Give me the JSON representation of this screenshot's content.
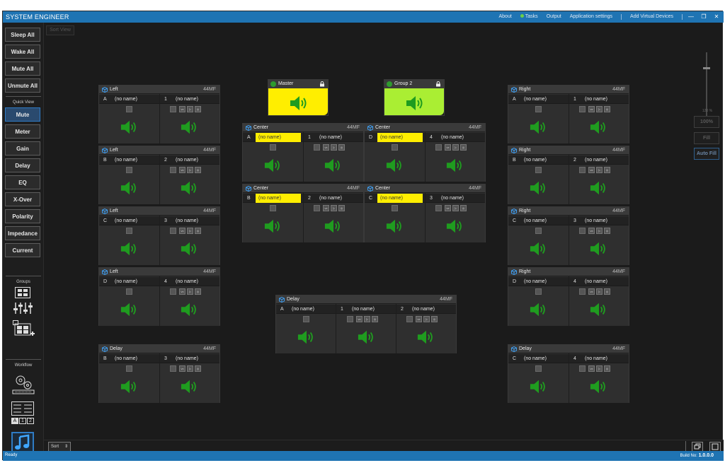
{
  "app": {
    "title": "SYSTEM ENGINEER",
    "menu": [
      "About",
      "Tasks",
      "Output",
      "Application settings",
      "Add Virtual Devices"
    ],
    "accent": "#1f74b3"
  },
  "sidebar": {
    "buttons": [
      "Sleep All",
      "Wake All",
      "Mute All",
      "Unmute All"
    ],
    "quick_view_label": "Quick View",
    "quick_view": [
      "Mute",
      "Meter",
      "Gain",
      "Delay",
      "EQ",
      "X-Over",
      "Polarity",
      "Impedance",
      "Current"
    ],
    "active_quick_view": "Mute",
    "groups_label": "Groups",
    "workflow_label": "Workflow",
    "icons": [
      "groups-grid-icon",
      "faders-icon",
      "add-group-icon",
      "settings-gears-icon",
      "list-order-icon",
      "music-note-icon"
    ],
    "order_labels": [
      "A",
      "1",
      "2"
    ]
  },
  "canvas": {
    "sort_view_label": "Sort View"
  },
  "right_rail": {
    "zoom_label": "120 %",
    "buttons": [
      "100%",
      "Fill",
      "Auto Fill"
    ]
  },
  "bottom": {
    "sort_label": "Sort"
  },
  "status": {
    "left": "Ready",
    "build_label": "Build No:",
    "build_value": "1.0.0.0"
  },
  "colors": {
    "speaker": "#1f9c1f",
    "highlight_name": "#ffee00",
    "master_group": "#ffee00",
    "group2": "#aaee33"
  },
  "groups": [
    {
      "name": "Master",
      "color": "#ffee00"
    },
    {
      "name": "Group 2",
      "color": "#aaee33"
    }
  ],
  "panels": [
    {
      "name": "Left",
      "model": "44MF",
      "channels": [
        {
          "label": "A",
          "name": "(no name)"
        },
        {
          "label": "1",
          "name": "(no name)"
        }
      ]
    },
    {
      "name": "Left",
      "model": "44MF",
      "channels": [
        {
          "label": "B",
          "name": "(no name)"
        },
        {
          "label": "2",
          "name": "(no name)"
        }
      ]
    },
    {
      "name": "Left",
      "model": "44MF",
      "channels": [
        {
          "label": "C",
          "name": "(no name)"
        },
        {
          "label": "3",
          "name": "(no name)"
        }
      ]
    },
    {
      "name": "Left",
      "model": "44MF",
      "channels": [
        {
          "label": "D",
          "name": "(no name)"
        },
        {
          "label": "4",
          "name": "(no name)"
        }
      ]
    },
    {
      "name": "Delay",
      "model": "44MF",
      "channels": [
        {
          "label": "B",
          "name": "(no name)"
        },
        {
          "label": "3",
          "name": "(no name)"
        }
      ]
    },
    {
      "name": "Center",
      "model": "44MF",
      "channels": [
        {
          "label": "A",
          "name": "(no name)",
          "hl": true
        },
        {
          "label": "1",
          "name": "(no name)"
        }
      ]
    },
    {
      "name": "Center",
      "model": "44MF",
      "channels": [
        {
          "label": "D",
          "name": "(no name)",
          "hl": true
        },
        {
          "label": "4",
          "name": "(no name)"
        }
      ]
    },
    {
      "name": "Center",
      "model": "44MF",
      "channels": [
        {
          "label": "B",
          "name": "(no name)",
          "hl": true
        },
        {
          "label": "2",
          "name": "(no name)"
        }
      ]
    },
    {
      "name": "Center",
      "model": "44MF",
      "channels": [
        {
          "label": "C",
          "name": "(no name)",
          "hl": true
        },
        {
          "label": "3",
          "name": "(no name)"
        }
      ]
    },
    {
      "name": "Delay",
      "model": "44MF",
      "channels": [
        {
          "label": "A",
          "name": "(no name)"
        },
        {
          "label": "1",
          "name": "(no name)"
        },
        {
          "label": "2",
          "name": "(no name)"
        }
      ]
    },
    {
      "name": "Right",
      "model": "44MF",
      "channels": [
        {
          "label": "A",
          "name": "(no name)"
        },
        {
          "label": "1",
          "name": "(no name)"
        }
      ]
    },
    {
      "name": "Right",
      "model": "44MF",
      "channels": [
        {
          "label": "B",
          "name": "(no name)"
        },
        {
          "label": "2",
          "name": "(no name)"
        }
      ]
    },
    {
      "name": "Right",
      "model": "44MF",
      "channels": [
        {
          "label": "C",
          "name": "(no name)"
        },
        {
          "label": "3",
          "name": "(no name)"
        }
      ]
    },
    {
      "name": "Right",
      "model": "44MF",
      "channels": [
        {
          "label": "D",
          "name": "(no name)"
        },
        {
          "label": "4",
          "name": "(no name)"
        }
      ]
    },
    {
      "name": "Delay",
      "model": "44MF",
      "channels": [
        {
          "label": "C",
          "name": "(no name)"
        },
        {
          "label": "4",
          "name": "(no name)"
        }
      ]
    }
  ]
}
